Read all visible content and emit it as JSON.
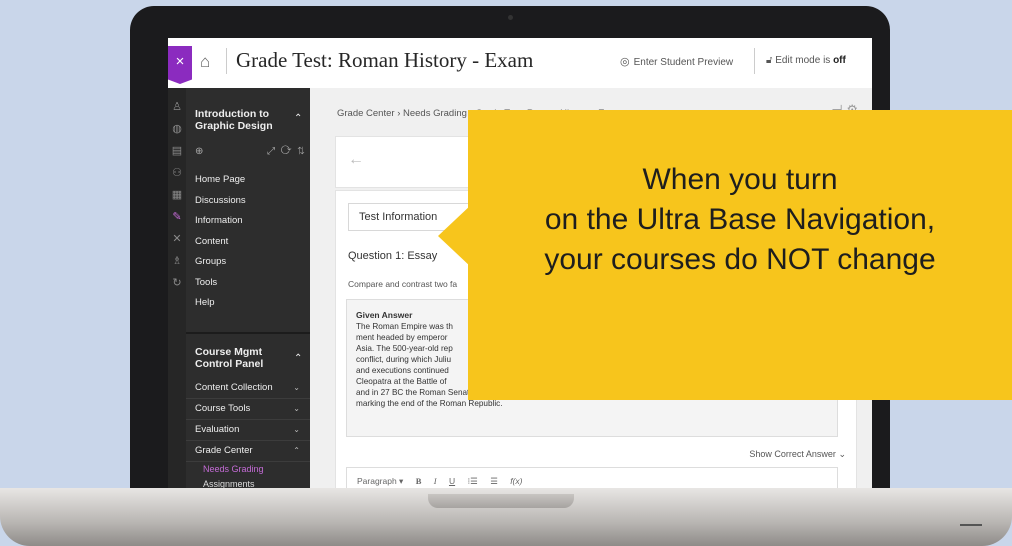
{
  "header": {
    "close_symbol": "×",
    "title": "Grade Test: Roman History - Exam",
    "preview_label": "Enter Student Preview",
    "edit_mode_prefix": "Edit mode is",
    "edit_mode_state": "off"
  },
  "rail_icons": [
    "user-icon",
    "globe-icon",
    "list-icon",
    "people-icon",
    "calendar-icon",
    "grade-icon",
    "tools-icon",
    "pupils-icon",
    "signout-icon"
  ],
  "course_nav": {
    "title": "Introduction to Graphic Design",
    "items": [
      "Home Page",
      "Discussions",
      "Information",
      "Content",
      "Groups",
      "Tools",
      "Help"
    ]
  },
  "control_panel": {
    "title": "Course Mgmt Control Panel",
    "rows": [
      "Content Collection",
      "Course Tools",
      "Evaluation",
      "Grade Center"
    ],
    "sub_items": [
      "Needs Grading",
      "Assignments"
    ]
  },
  "main": {
    "breadcrumb": "Grade Center › Needs Grading › Grade Test: Roman History - Exam",
    "test_info_label": "Test Information",
    "question_title": "Question 1: Essay",
    "question_desc": "Compare and contrast two fa",
    "answer_label": "Given Answer",
    "answer_lines": [
      "The Roman Empire was th",
      "ment headed by emperor",
      "Asia. The 500-year-old rep",
      "conflict, during which Juliu",
      "and executions continued",
      "Cleopatra at the Battle of",
      "and in 27 BC the Roman Senate formally granted him overarching power and the new title Augustus, effectively",
      "marking the end of the Roman Republic."
    ],
    "show_correct": "Show Correct Answer",
    "editor_toolbar": [
      "Paragraph ▾",
      "B",
      "I",
      "U",
      "⁝☰",
      "☰",
      "f(x)"
    ]
  },
  "callout": {
    "line1": "When you turn",
    "line2": "on the Ultra Base Navigation,",
    "line3": "your courses do NOT change"
  },
  "colors": {
    "accent": "#8b2bbf",
    "highlight": "#c46bd6",
    "callout": "#f7c51c",
    "nav_bg": "#2d2d2d",
    "background": "#c9d6ea"
  }
}
